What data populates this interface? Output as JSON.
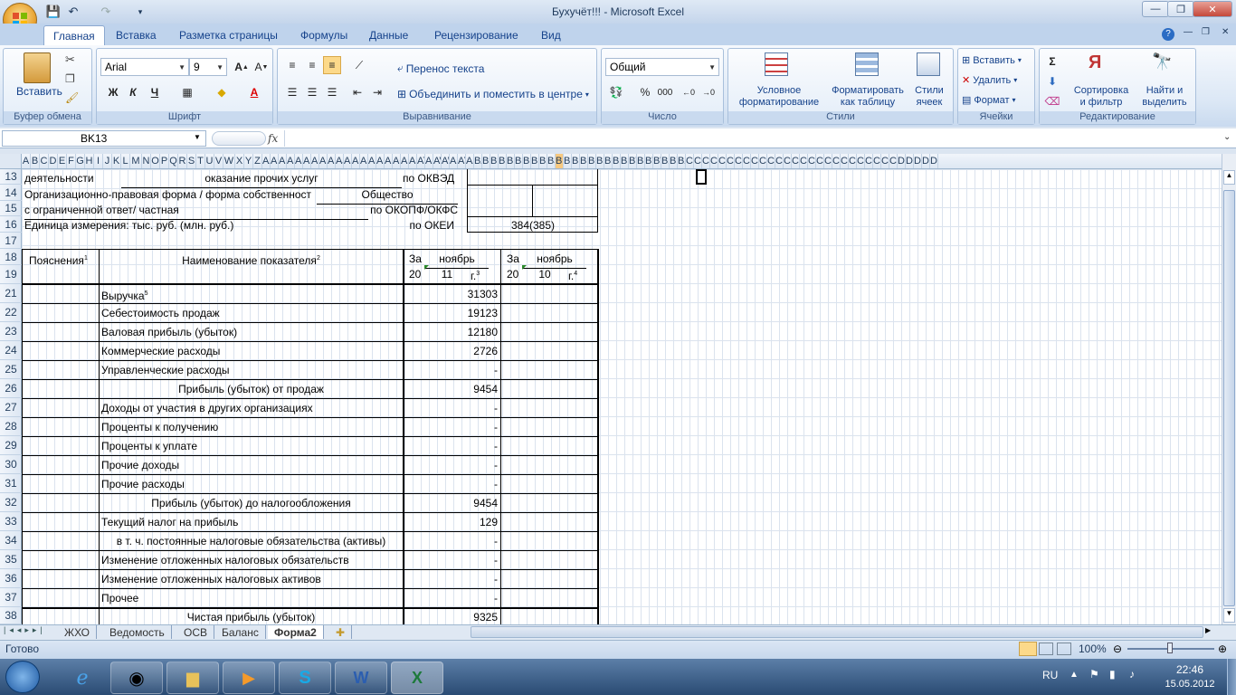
{
  "window": {
    "title": "Бухучёт!!! - Microsoft Excel",
    "minimize": "—",
    "restore": "❐",
    "close": "✕"
  },
  "ribbon_tabs": [
    "Главная",
    "Вставка",
    "Разметка страницы",
    "Формулы",
    "Данные",
    "Рецензирование",
    "Вид"
  ],
  "ribbon": {
    "clipboard": {
      "paste": "Вставить",
      "label": "Буфер обмена"
    },
    "font": {
      "name": "Arial",
      "size": "9",
      "label": "Шрифт",
      "bold": "Ж",
      "italic": "К",
      "underline": "Ч"
    },
    "alignment": {
      "wrap": "Перенос текста",
      "merge": "Объединить и поместить в центре",
      "label": "Выравнивание"
    },
    "number": {
      "format": "Общий",
      "label": "Число",
      "percent": "%",
      "thousands": "000"
    },
    "styles": {
      "conditional": "Условное форматирование",
      "as_table": "Форматировать как таблицу",
      "cell_styles": "Стили ячеек",
      "label": "Стили"
    },
    "cells": {
      "insert": "Вставить",
      "delete": "Удалить",
      "format": "Формат",
      "label": "Ячейки"
    },
    "editing": {
      "sort": "Сортировка и фильтр",
      "find": "Найти и выделить",
      "label": "Редактирование"
    }
  },
  "formula_bar": {
    "name_box": "BK13",
    "fx": "fx",
    "content": ""
  },
  "columns": [
    "A",
    "B",
    "C",
    "D",
    "E",
    "F",
    "G",
    "H",
    "I",
    "J",
    "K",
    "L",
    "M",
    "N",
    "O",
    "P",
    "Q",
    "R",
    "S",
    "T",
    "U",
    "V",
    "W",
    "X",
    "Y",
    "Z",
    "AA",
    "AB",
    "AC",
    "AD",
    "AE",
    "AF",
    "AG",
    "AH",
    "AI",
    "AJ",
    "AK",
    "AL",
    "AM",
    "AN",
    "AO",
    "AP",
    "AQ",
    "AR",
    "AS",
    "AT",
    "AU",
    "AV",
    "AW",
    "AX",
    "AY",
    "AZ",
    "BA",
    "BB",
    "BC",
    "BD",
    "BE",
    "BF",
    "BG",
    "BH",
    "BI",
    "BJ",
    "BK",
    "BL",
    "BM",
    "BN",
    "BO",
    "BP",
    "BQ",
    "BR",
    "BS",
    "BT",
    "BU",
    "BV",
    "BW",
    "BX",
    "BY",
    "BZ",
    "CA",
    "CB",
    "CC",
    "CD",
    "CE",
    "CF",
    "CG",
    "CH",
    "CI",
    "CJ",
    "CK",
    "CL",
    "CM",
    "CN",
    "CO",
    "CP",
    "CQ",
    "CR",
    "CS",
    "CT",
    "CU",
    "CV",
    "CW",
    "CX",
    "CY",
    "CZ",
    "DA",
    "DB",
    "DC",
    "DD",
    "DE"
  ],
  "rows": [
    "13",
    "14",
    "15",
    "16",
    "17",
    "18",
    "19",
    "21",
    "22",
    "23",
    "24",
    "25",
    "26",
    "27",
    "28",
    "29",
    "30",
    "31",
    "32",
    "33",
    "34",
    "35",
    "36",
    "37",
    "38"
  ],
  "header_block": {
    "r13_a": "деятельности",
    "r13_b": "оказание прочих услуг",
    "r13_c": "по ОКВЭД",
    "r14_a": "Организационно-правовая форма / форма собственност",
    "r14_b": "Общество",
    "r15_a": "с ограниченной ответ/ частная",
    "r15_c": "по ОКОПФ/ОКФС",
    "r16_a": "Единица измерения: тыс. руб. (млн. руб.)",
    "r16_c": "по ОКЕИ",
    "r16_d": "384(385)"
  },
  "table_header": {
    "explanations": "Пояснения",
    "explanations_sup": "1",
    "indicator": "Наименование показателя",
    "indicator_sup": "2",
    "col1_za": "За",
    "col1_month": "ноябрь",
    "col1_20": "20",
    "col1_year": "11",
    "col1_g": "г.",
    "col1_sup": "3",
    "col2_za": "За",
    "col2_month": "ноябрь",
    "col2_20": "20",
    "col2_year": "10",
    "col2_g": "г.",
    "col2_sup": "4"
  },
  "report_rows": [
    {
      "row": "21",
      "name": "Выручка",
      "sup": "5",
      "value": "31303",
      "indent": "left"
    },
    {
      "row": "22",
      "name": "Себестоимость продаж",
      "sup": "",
      "value": "19123",
      "indent": "left"
    },
    {
      "row": "23",
      "name": "Валовая прибыль (убыток)",
      "sup": "",
      "value": "12180",
      "indent": "left"
    },
    {
      "row": "24",
      "name": "Коммерческие расходы",
      "sup": "",
      "value": "2726",
      "indent": "left"
    },
    {
      "row": "25",
      "name": "Управленческие расходы",
      "sup": "",
      "value": "-",
      "indent": "left"
    },
    {
      "row": "26",
      "name": "Прибыль (убыток) от продаж",
      "sup": "",
      "value": "9454",
      "indent": "center"
    },
    {
      "row": "27",
      "name": "Доходы от участия в других организациях",
      "sup": "",
      "value": "-",
      "indent": "left"
    },
    {
      "row": "28",
      "name": "Проценты к получению",
      "sup": "",
      "value": "-",
      "indent": "left"
    },
    {
      "row": "29",
      "name": "Проценты к уплате",
      "sup": "",
      "value": "-",
      "indent": "left"
    },
    {
      "row": "30",
      "name": "Прочие доходы",
      "sup": "",
      "value": "-",
      "indent": "left"
    },
    {
      "row": "31",
      "name": "Прочие расходы",
      "sup": "",
      "value": "-",
      "indent": "left"
    },
    {
      "row": "32",
      "name": "Прибыль (убыток) до налогообложения",
      "sup": "",
      "value": "9454",
      "indent": "center"
    },
    {
      "row": "33",
      "name": "Текущий налог на прибыль",
      "sup": "",
      "value": "129",
      "indent": "left"
    },
    {
      "row": "34",
      "name": "в т. ч. постоянные налоговые обязательства (активы)",
      "sup": "",
      "value": "-",
      "indent": "center"
    },
    {
      "row": "35",
      "name": "Изменение отложенных налоговых обязательств",
      "sup": "",
      "value": "-",
      "indent": "left"
    },
    {
      "row": "36",
      "name": "Изменение отложенных налоговых активов",
      "sup": "",
      "value": "-",
      "indent": "left"
    },
    {
      "row": "37",
      "name": "Прочее",
      "sup": "",
      "value": "-",
      "indent": "left"
    },
    {
      "row": "38",
      "name": "Чистая прибыль (убыток)",
      "sup": "",
      "value": "9325",
      "indent": "center"
    }
  ],
  "sheet_tabs": [
    "ЖХО",
    "Ведомость",
    "ОСВ",
    "Баланс",
    "Форма2"
  ],
  "active_sheet": "Форма2",
  "status": {
    "ready": "Готово",
    "zoom": "100%"
  },
  "taskbar": {
    "lang": "RU",
    "time": "22:46",
    "date": "15.05.2012"
  }
}
